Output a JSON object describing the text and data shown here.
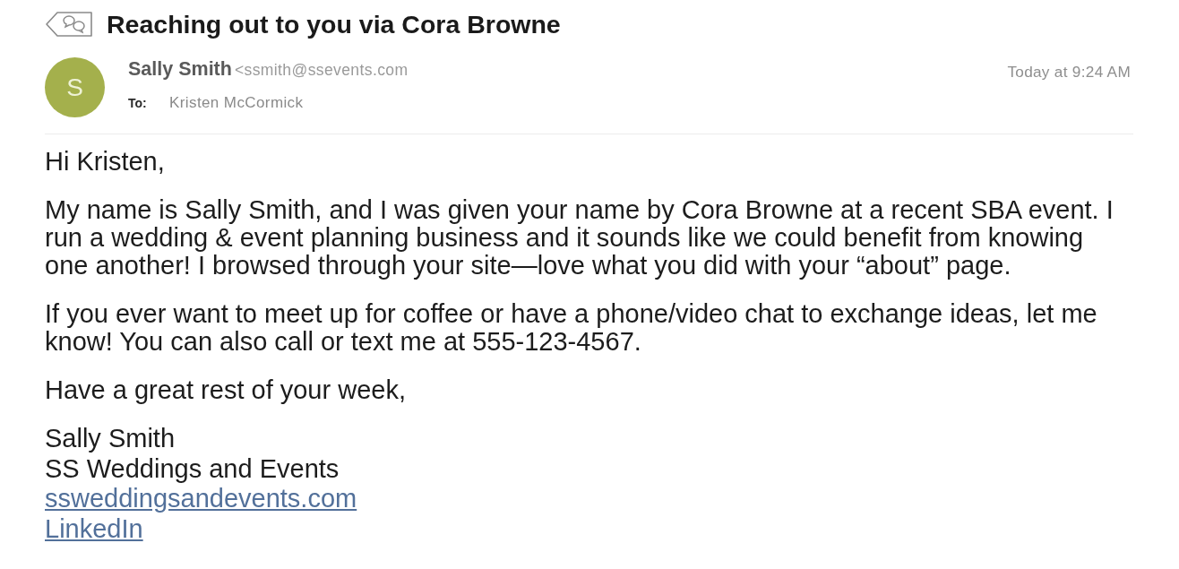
{
  "message": {
    "subject": "Reaching out to you via Cora Browne",
    "sender": {
      "initial": "S",
      "name": "Sally Smith",
      "email": "<ssmith@ssevents.com"
    },
    "to_label": "To:",
    "recipient": "Kristen McCormick",
    "date": "Today at 9:24 AM"
  },
  "body": {
    "paragraphs": [
      "Hi Kristen,",
      "My name is Sally Smith, and I was given your name by Cora Browne at a recent SBA event. I run a wedding & event planning business and it sounds like we could benefit from knowing one another! I browsed through your site—love what you did with your “about” page.",
      "If you ever want to meet up for coffee or have a phone/video chat to exchange ideas, let me know! You can also call or text me at 555-123-4567.",
      "Have a great rest of your week,"
    ],
    "signature": [
      {
        "kind": "text",
        "text": "Sally Smith"
      },
      {
        "kind": "text",
        "text": "SS Weddings and Events"
      },
      {
        "kind": "link",
        "text": "ssweddingsandevents.com"
      },
      {
        "kind": "link",
        "text": "LinkedIn"
      }
    ]
  }
}
